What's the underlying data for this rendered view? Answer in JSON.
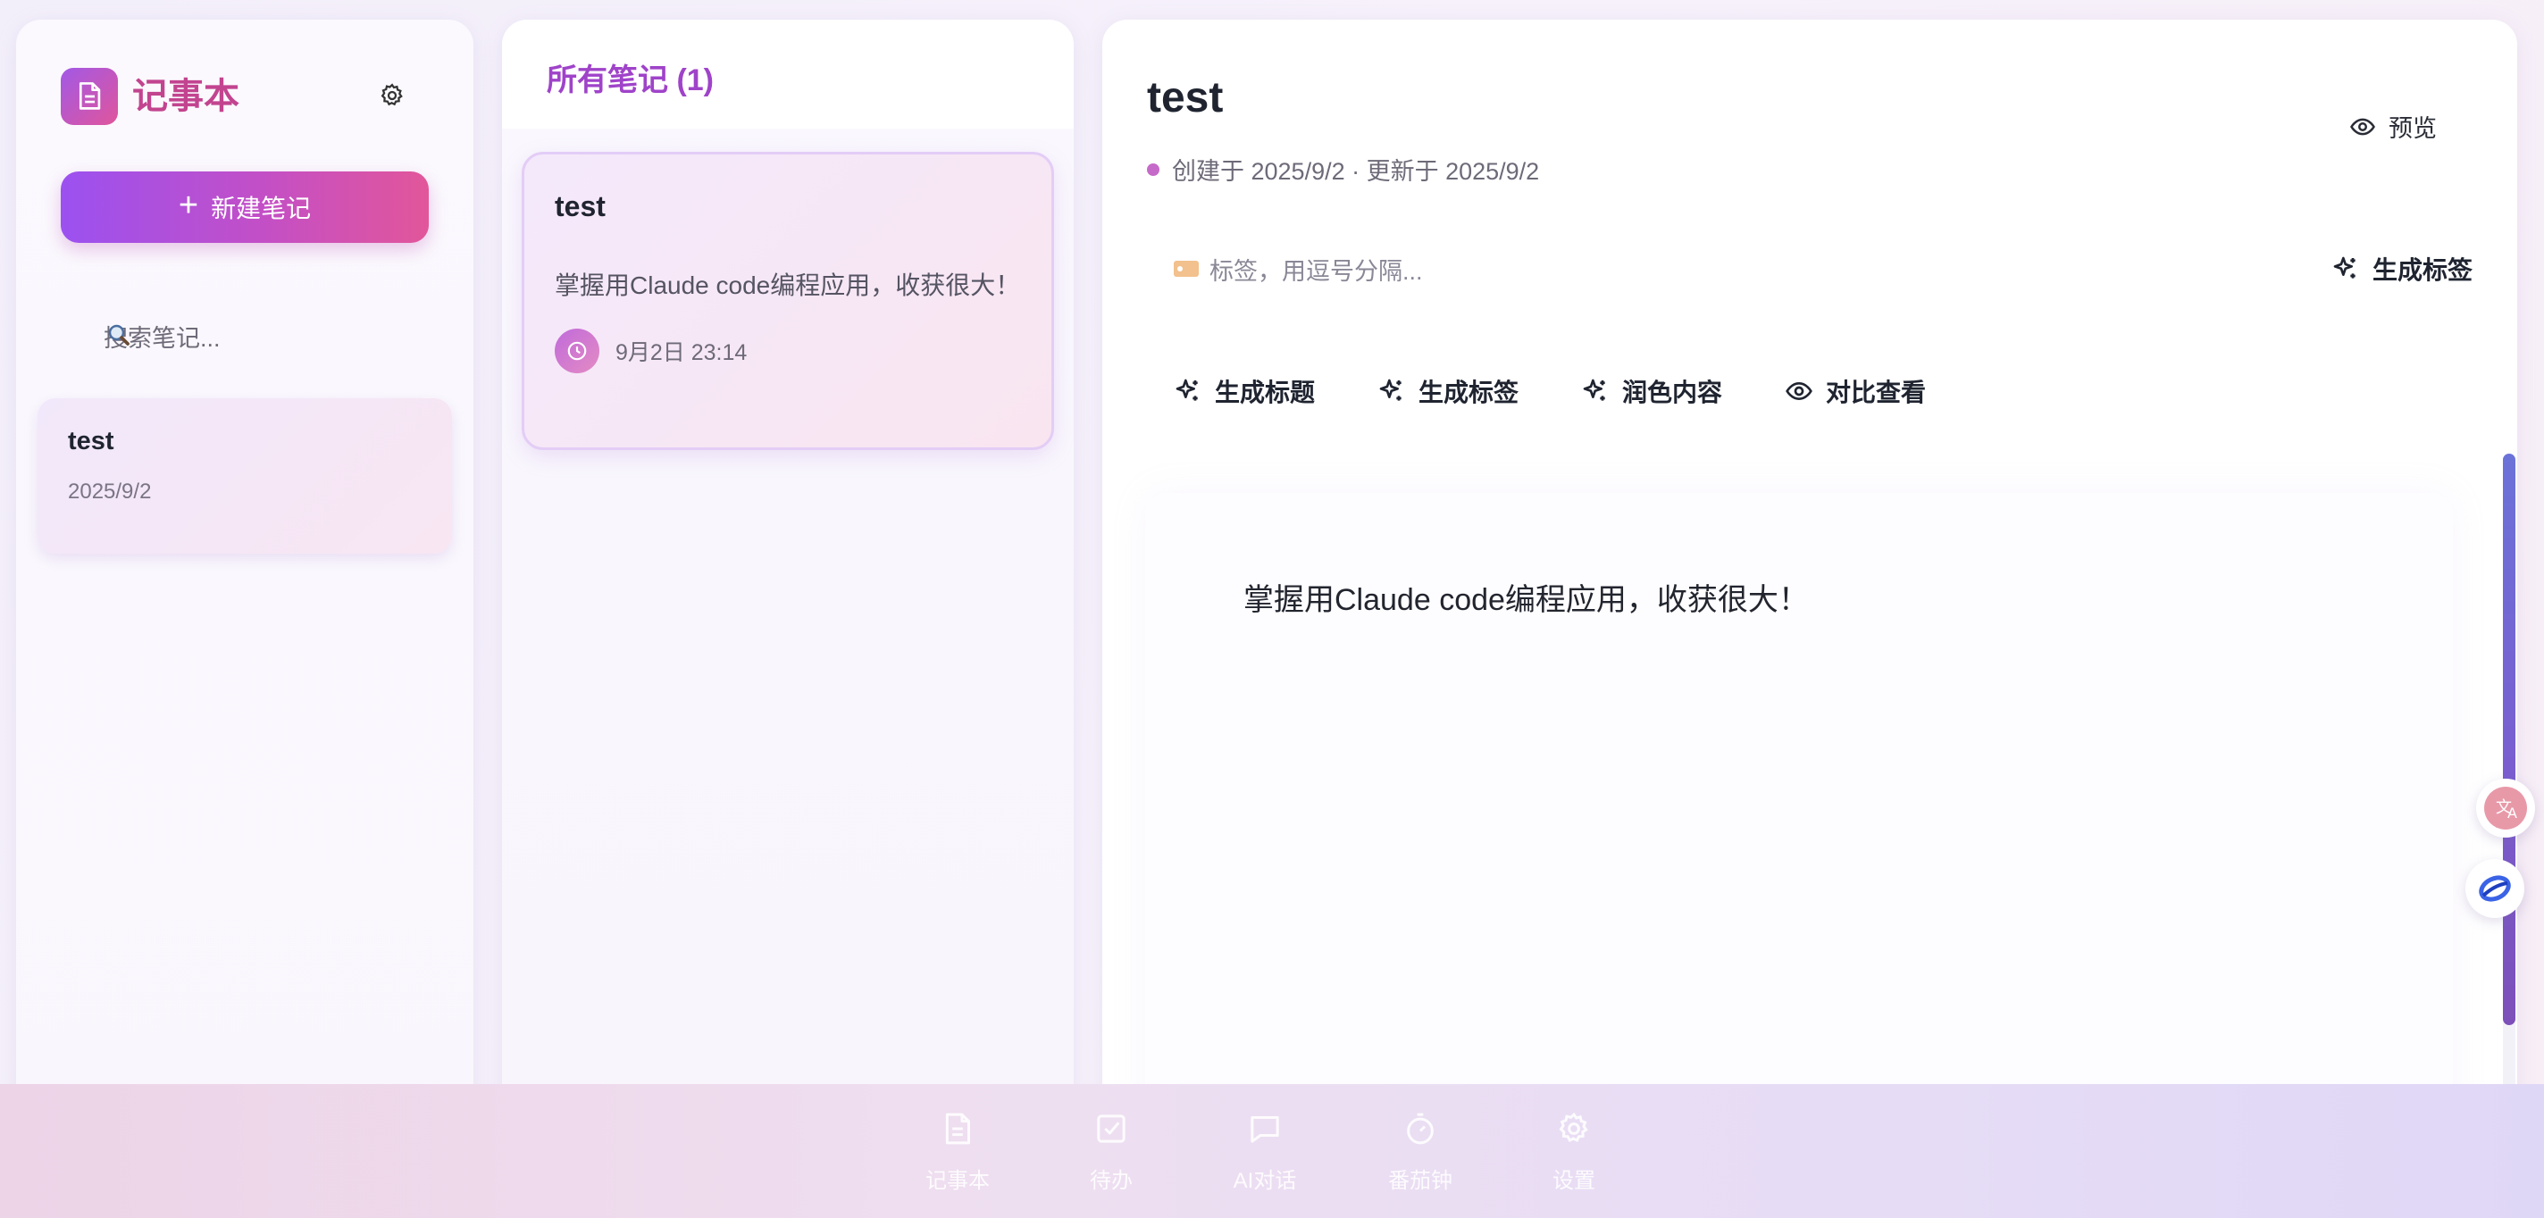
{
  "sidebar": {
    "app_title": "记事本",
    "new_note_label": "新建笔记",
    "search_placeholder": "搜索笔记...",
    "notes": [
      {
        "title": "test",
        "date": "2025/9/2"
      }
    ]
  },
  "list": {
    "heading": "所有笔记 (1)",
    "cards": [
      {
        "title": "test",
        "preview": "掌握用Claude code编程应用，收获很大！",
        "time": "9月2日 23:14"
      }
    ]
  },
  "editor": {
    "title": "test",
    "meta": "创建于 2025/9/2 · 更新于 2025/9/2",
    "preview_label": "预览",
    "tags_placeholder": "标签，用逗号分隔...",
    "generate_tags_label": "生成标签",
    "tools": [
      {
        "label": "生成标题",
        "icon": "sparkles-icon"
      },
      {
        "label": "生成标签",
        "icon": "sparkles-icon"
      },
      {
        "label": "润色内容",
        "icon": "sparkles-icon"
      },
      {
        "label": "对比查看",
        "icon": "eye-icon"
      }
    ],
    "content": "掌握用Claude code编程应用，收获很大！"
  },
  "bottom_nav": [
    {
      "label": "记事本",
      "icon": "note-icon"
    },
    {
      "label": "待办",
      "icon": "checkbox-icon"
    },
    {
      "label": "AI对话",
      "icon": "chat-icon"
    },
    {
      "label": "番茄钟",
      "icon": "timer-icon"
    },
    {
      "label": "设置",
      "icon": "gear-icon"
    }
  ],
  "colors": {
    "accent_purple": "#9b51f0",
    "accent_pink": "#e2569a",
    "heading_purple": "#9f43c9"
  }
}
